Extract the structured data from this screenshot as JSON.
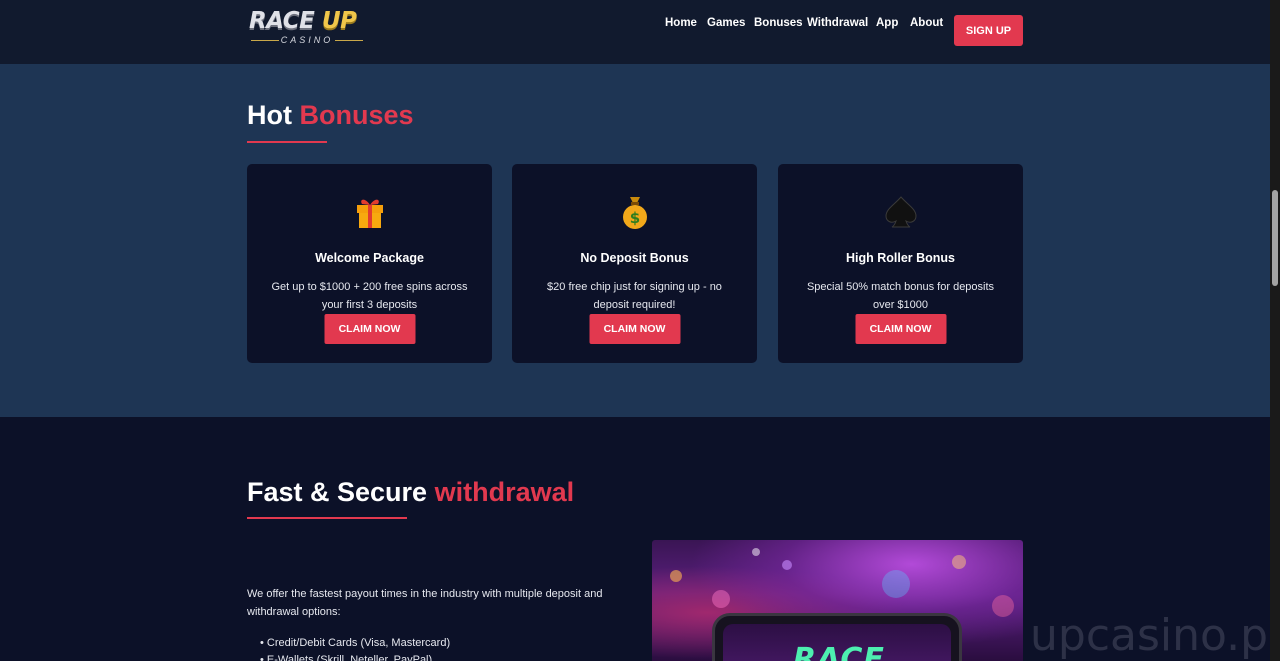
{
  "header": {
    "logo_main_a": "RACE",
    "logo_main_b": "UP",
    "logo_sub": "CASINO",
    "nav": [
      {
        "label": "Home"
      },
      {
        "label": "Games"
      },
      {
        "label": "Bonuses"
      },
      {
        "label": "Withdrawal"
      },
      {
        "label": "App"
      },
      {
        "label": "About"
      }
    ],
    "signup_label": "SIGN UP"
  },
  "bonuses": {
    "title_a": "Hot",
    "title_b": "Bonuses",
    "cards": [
      {
        "icon": "gift-icon",
        "title": "Welcome Package",
        "text": "Get up to $1000 + 200 free spins across your first 3 deposits",
        "button": "CLAIM NOW"
      },
      {
        "icon": "money-bag-icon",
        "title": "No Deposit Bonus",
        "text": "$20 free chip just for signing up - no deposit required!",
        "button": "CLAIM NOW"
      },
      {
        "icon": "spade-icon",
        "title": "High Roller Bonus",
        "text": "Special 50% match bonus for deposits over $1000",
        "button": "CLAIM NOW"
      }
    ]
  },
  "withdrawal": {
    "title_a": "Fast & Secure",
    "title_b": "withdrawal",
    "intro": "We offer the fastest payout times in the industry with multiple deposit and withdrawal options:",
    "options": [
      "Credit/Debit Cards (Visa, Mastercard)",
      "E-Wallets (Skrill, Neteller, PayPal)"
    ],
    "promo_image_text": "RACE"
  },
  "watermark": "upcasino.pl",
  "colors": {
    "accent": "#e2394f",
    "header_bg": "#111a2e",
    "section_bg": "#1e3554",
    "card_bg": "#0c1128"
  }
}
